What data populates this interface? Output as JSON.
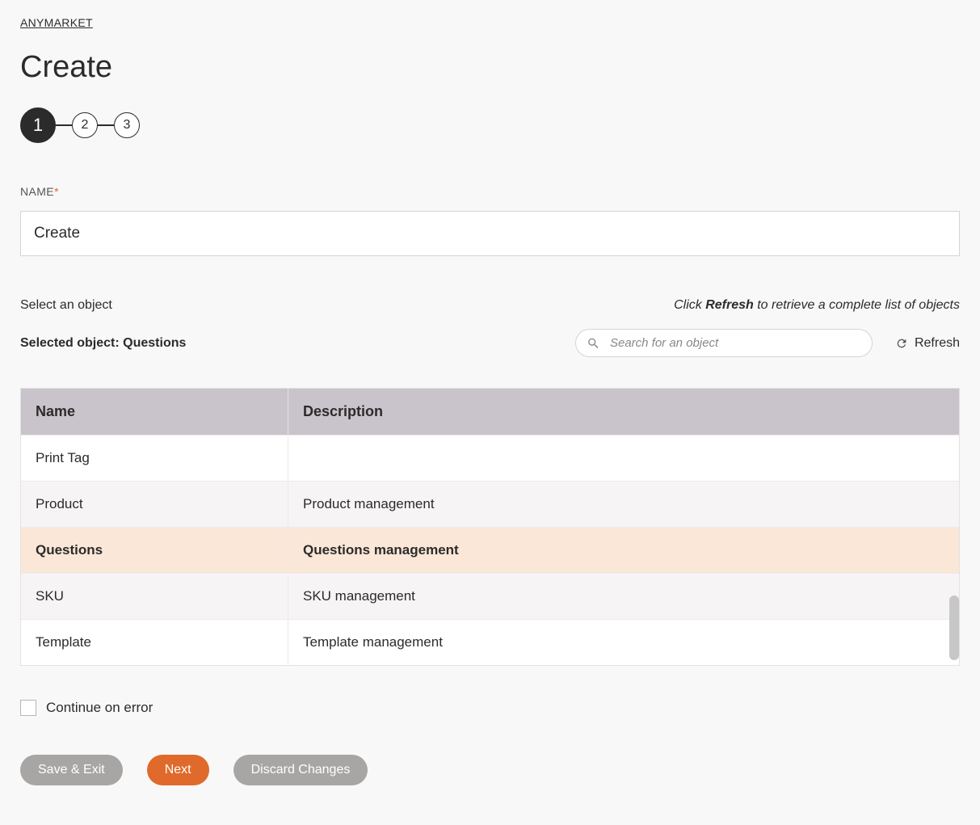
{
  "breadcrumb": "ANYMARKET",
  "page_title": "Create",
  "stepper": {
    "steps": [
      "1",
      "2",
      "3"
    ],
    "active": 0
  },
  "name_field": {
    "label": "NAME",
    "required_mark": "*",
    "value": "Create"
  },
  "object_section": {
    "select_label": "Select an object",
    "hint_prefix": "Click ",
    "hint_bold": "Refresh",
    "hint_suffix": " to retrieve a complete list of objects",
    "selected_prefix": "Selected object: ",
    "selected_value": "Questions",
    "search_placeholder": "Search for an object",
    "refresh_label": "Refresh"
  },
  "table": {
    "headers": {
      "name": "Name",
      "description": "Description"
    },
    "rows": [
      {
        "name": "Print Tag",
        "description": "",
        "selected": false
      },
      {
        "name": "Product",
        "description": "Product management",
        "selected": false
      },
      {
        "name": "Questions",
        "description": "Questions management",
        "selected": true
      },
      {
        "name": "SKU",
        "description": "SKU management",
        "selected": false
      },
      {
        "name": "Template",
        "description": "Template management",
        "selected": false
      }
    ]
  },
  "continue_on_error": {
    "label": "Continue on error",
    "checked": false
  },
  "footer": {
    "save_exit": "Save & Exit",
    "next": "Next",
    "discard": "Discard Changes"
  }
}
